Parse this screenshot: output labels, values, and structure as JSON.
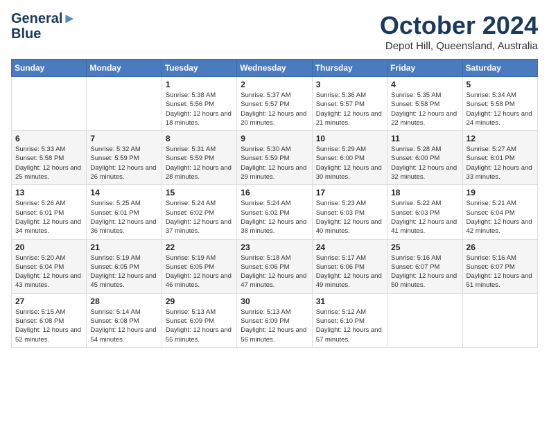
{
  "header": {
    "logo_line1": "General",
    "logo_line2": "Blue",
    "month_title": "October 2024",
    "subtitle": "Depot Hill, Queensland, Australia"
  },
  "weekdays": [
    "Sunday",
    "Monday",
    "Tuesday",
    "Wednesday",
    "Thursday",
    "Friday",
    "Saturday"
  ],
  "weeks": [
    [
      {
        "day": "",
        "sunrise": "",
        "sunset": "",
        "daylight": ""
      },
      {
        "day": "",
        "sunrise": "",
        "sunset": "",
        "daylight": ""
      },
      {
        "day": "1",
        "sunrise": "Sunrise: 5:38 AM",
        "sunset": "Sunset: 5:56 PM",
        "daylight": "Daylight: 12 hours and 18 minutes."
      },
      {
        "day": "2",
        "sunrise": "Sunrise: 5:37 AM",
        "sunset": "Sunset: 5:57 PM",
        "daylight": "Daylight: 12 hours and 20 minutes."
      },
      {
        "day": "3",
        "sunrise": "Sunrise: 5:36 AM",
        "sunset": "Sunset: 5:57 PM",
        "daylight": "Daylight: 12 hours and 21 minutes."
      },
      {
        "day": "4",
        "sunrise": "Sunrise: 5:35 AM",
        "sunset": "Sunset: 5:58 PM",
        "daylight": "Daylight: 12 hours and 22 minutes."
      },
      {
        "day": "5",
        "sunrise": "Sunrise: 5:34 AM",
        "sunset": "Sunset: 5:58 PM",
        "daylight": "Daylight: 12 hours and 24 minutes."
      }
    ],
    [
      {
        "day": "6",
        "sunrise": "Sunrise: 5:33 AM",
        "sunset": "Sunset: 5:58 PM",
        "daylight": "Daylight: 12 hours and 25 minutes."
      },
      {
        "day": "7",
        "sunrise": "Sunrise: 5:32 AM",
        "sunset": "Sunset: 5:59 PM",
        "daylight": "Daylight: 12 hours and 26 minutes."
      },
      {
        "day": "8",
        "sunrise": "Sunrise: 5:31 AM",
        "sunset": "Sunset: 5:59 PM",
        "daylight": "Daylight: 12 hours and 28 minutes."
      },
      {
        "day": "9",
        "sunrise": "Sunrise: 5:30 AM",
        "sunset": "Sunset: 5:59 PM",
        "daylight": "Daylight: 12 hours and 29 minutes."
      },
      {
        "day": "10",
        "sunrise": "Sunrise: 5:29 AM",
        "sunset": "Sunset: 6:00 PM",
        "daylight": "Daylight: 12 hours and 30 minutes."
      },
      {
        "day": "11",
        "sunrise": "Sunrise: 5:28 AM",
        "sunset": "Sunset: 6:00 PM",
        "daylight": "Daylight: 12 hours and 32 minutes."
      },
      {
        "day": "12",
        "sunrise": "Sunrise: 5:27 AM",
        "sunset": "Sunset: 6:01 PM",
        "daylight": "Daylight: 12 hours and 33 minutes."
      }
    ],
    [
      {
        "day": "13",
        "sunrise": "Sunrise: 5:26 AM",
        "sunset": "Sunset: 6:01 PM",
        "daylight": "Daylight: 12 hours and 34 minutes."
      },
      {
        "day": "14",
        "sunrise": "Sunrise: 5:25 AM",
        "sunset": "Sunset: 6:01 PM",
        "daylight": "Daylight: 12 hours and 36 minutes."
      },
      {
        "day": "15",
        "sunrise": "Sunrise: 5:24 AM",
        "sunset": "Sunset: 6:02 PM",
        "daylight": "Daylight: 12 hours and 37 minutes."
      },
      {
        "day": "16",
        "sunrise": "Sunrise: 5:24 AM",
        "sunset": "Sunset: 6:02 PM",
        "daylight": "Daylight: 12 hours and 38 minutes."
      },
      {
        "day": "17",
        "sunrise": "Sunrise: 5:23 AM",
        "sunset": "Sunset: 6:03 PM",
        "daylight": "Daylight: 12 hours and 40 minutes."
      },
      {
        "day": "18",
        "sunrise": "Sunrise: 5:22 AM",
        "sunset": "Sunset: 6:03 PM",
        "daylight": "Daylight: 12 hours and 41 minutes."
      },
      {
        "day": "19",
        "sunrise": "Sunrise: 5:21 AM",
        "sunset": "Sunset: 6:04 PM",
        "daylight": "Daylight: 12 hours and 42 minutes."
      }
    ],
    [
      {
        "day": "20",
        "sunrise": "Sunrise: 5:20 AM",
        "sunset": "Sunset: 6:04 PM",
        "daylight": "Daylight: 12 hours and 43 minutes."
      },
      {
        "day": "21",
        "sunrise": "Sunrise: 5:19 AM",
        "sunset": "Sunset: 6:05 PM",
        "daylight": "Daylight: 12 hours and 45 minutes."
      },
      {
        "day": "22",
        "sunrise": "Sunrise: 5:19 AM",
        "sunset": "Sunset: 6:05 PM",
        "daylight": "Daylight: 12 hours and 46 minutes."
      },
      {
        "day": "23",
        "sunrise": "Sunrise: 5:18 AM",
        "sunset": "Sunset: 6:06 PM",
        "daylight": "Daylight: 12 hours and 47 minutes."
      },
      {
        "day": "24",
        "sunrise": "Sunrise: 5:17 AM",
        "sunset": "Sunset: 6:06 PM",
        "daylight": "Daylight: 12 hours and 49 minutes."
      },
      {
        "day": "25",
        "sunrise": "Sunrise: 5:16 AM",
        "sunset": "Sunset: 6:07 PM",
        "daylight": "Daylight: 12 hours and 50 minutes."
      },
      {
        "day": "26",
        "sunrise": "Sunrise: 5:16 AM",
        "sunset": "Sunset: 6:07 PM",
        "daylight": "Daylight: 12 hours and 51 minutes."
      }
    ],
    [
      {
        "day": "27",
        "sunrise": "Sunrise: 5:15 AM",
        "sunset": "Sunset: 6:08 PM",
        "daylight": "Daylight: 12 hours and 52 minutes."
      },
      {
        "day": "28",
        "sunrise": "Sunrise: 5:14 AM",
        "sunset": "Sunset: 6:08 PM",
        "daylight": "Daylight: 12 hours and 54 minutes."
      },
      {
        "day": "29",
        "sunrise": "Sunrise: 5:13 AM",
        "sunset": "Sunset: 6:09 PM",
        "daylight": "Daylight: 12 hours and 55 minutes."
      },
      {
        "day": "30",
        "sunrise": "Sunrise: 5:13 AM",
        "sunset": "Sunset: 6:09 PM",
        "daylight": "Daylight: 12 hours and 56 minutes."
      },
      {
        "day": "31",
        "sunrise": "Sunrise: 5:12 AM",
        "sunset": "Sunset: 6:10 PM",
        "daylight": "Daylight: 12 hours and 57 minutes."
      },
      {
        "day": "",
        "sunrise": "",
        "sunset": "",
        "daylight": ""
      },
      {
        "day": "",
        "sunrise": "",
        "sunset": "",
        "daylight": ""
      }
    ]
  ]
}
